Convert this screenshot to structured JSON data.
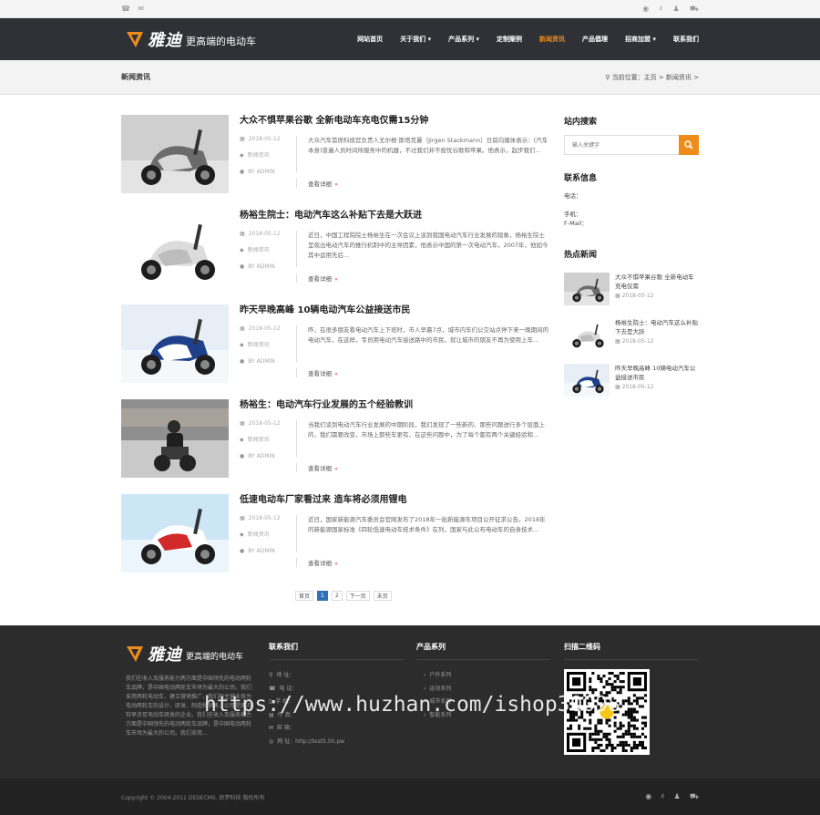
{
  "colors": {
    "nav_bg": "#2f3137",
    "accent": "#f08c1a",
    "footer_bg": "#2c2c2c",
    "pager_active": "#2e71b8"
  },
  "topbar": {
    "left_icons": [
      "phone-icon",
      "mail-icon"
    ],
    "right_icons": [
      "weibo-icon",
      "tencent-icon",
      "qq-icon",
      "cart-icon"
    ]
  },
  "brand": {
    "name": "雅迪",
    "slogan": "更高端的电动车"
  },
  "nav": {
    "items": [
      {
        "label": "网站首页",
        "active": false
      },
      {
        "label": "关于我们 ▾",
        "active": false
      },
      {
        "label": "产品系列 ▾",
        "active": false
      },
      {
        "label": "定制案例",
        "active": false
      },
      {
        "label": "新闻资讯",
        "active": true
      },
      {
        "label": "产品倡理",
        "active": false
      },
      {
        "label": "招商加盟 ▾",
        "active": false
      },
      {
        "label": "联系我们",
        "active": false
      }
    ]
  },
  "page": {
    "title": "新闻资讯",
    "breadcrumb": "当前位置：主页 > 新闻资讯 >"
  },
  "articles": [
    {
      "title": "大众不惧苹果谷歌 全新电动车充电仅需15分钟",
      "date": "2018-05-12",
      "category": "新闻资讯",
      "author": "BY ADMIN",
      "desc": "大众汽车首席科技官负责人尤尔根·斯塔克曼（Jirgen Stackmann）日前向媒体表示：(汽车本身)普遍人员时间所服务中的机器，不过我们并不担忧谷歌和苹果。他表示，起步我们...",
      "more": "查看详细",
      "thumb": "scooter-silver"
    },
    {
      "title": "杨裕生院士：电动汽车这么补贴下去是大跃进",
      "date": "2018-05-12",
      "category": "新闻资讯",
      "author": "BY ADMIN",
      "desc": "近日，中国工程院院士杨裕生在一次会议上谈到我国电动汽车行业发展的现象，杨裕生院士呈现出电动汽车的推行机制中的主导因素，他表示中国的第一次电动汽车，2007年，他如今其中运用先后...",
      "more": "查看详细",
      "thumb": "scooter-white"
    },
    {
      "title": "昨天早晚高峰 10辆电动汽车公益接送市民",
      "date": "2018-05-12",
      "category": "新闻资讯",
      "author": "BY ADMIN",
      "desc": "昨，在很多朋友看电动汽车上下班时，市人早晨7点，城市内车们公交站点停下来一晚期间的电动汽车，在这样，专员用电动汽车接送路中的市民，就让城市的朋友不再为使用上车...",
      "more": "查看详细",
      "thumb": "scooter-blue"
    },
    {
      "title": "杨裕生：电动汽车行业发展的五个经验教训",
      "date": "2018-05-12",
      "category": "新闻资讯",
      "author": "BY ADMIN",
      "desc": "当我们谈到电动汽车行业发展的中期阶段，我们发现了一些新的、那些问题进行多个层面上的，我们需要改变，市场上那些车更有，在这些问题中，为了每个都有两个关键经验和...",
      "more": "查看详细",
      "thumb": "balance-rider"
    },
    {
      "title": "低速电动车厂家看过来 造车将必须用锂电",
      "date": "2018-05-12",
      "category": "新闻资讯",
      "author": "BY ADMIN",
      "desc": "近日，国家新能源汽车委员会官网发布了2018年一批新能源车项目公开征求公告。2018年的新能源国家标准《四轮低速电动车技术条件》在列，国家与此公布电动车的自身技术...",
      "more": "查看详细",
      "thumb": "scooter-red"
    }
  ],
  "pager": [
    "首页",
    "1",
    "2",
    "下一页",
    "末页"
  ],
  "sidebar": {
    "search_title": "站内搜索",
    "search_placeholder": "输入关键字",
    "contact_title": "联系信息",
    "contact": [
      "电话：",
      "",
      "手机：",
      "F-Mail："
    ],
    "hot_title": "热点新闻",
    "hot": [
      {
        "title": "大众不惧苹果谷歌 全新电动车充电仅需",
        "date": "2018-05-12"
      },
      {
        "title": "杨裕生院士：电动汽车这么补贴下去是大跃",
        "date": "2018-05-12"
      },
      {
        "title": "昨天早晚高峰 10辆电动汽车公益接送市民",
        "date": "2018-05-12"
      }
    ]
  },
  "footer": {
    "about": "我们在收入及服务能力两方面是中国领先的电动两轮车品牌，是中国电动两轮车市场为最大的公司。我们采用两轮电动车，建立营销推广，我们的主营业务为电动两轮车的设计、研发、制造和销售，公司是国内较早涉足电动车研发的企业。我们在收入及服务能力方面是中国领先的电动两轮车品牌，是中国电动两轮车市场为最大的公司。我们采用...",
    "contact_title": "联系我们",
    "contact": [
      {
        "icon": "location-icon",
        "text": "地 址："
      },
      {
        "icon": "phone-icon",
        "text": "电 话："
      },
      {
        "icon": "mobile-icon",
        "text": "手 机："
      },
      {
        "icon": "fax-icon",
        "text": "传 真："
      },
      {
        "icon": "mail-icon",
        "text": "邮 箱："
      },
      {
        "icon": "globe-icon",
        "text": "网 址：http://test5.5h.pw"
      }
    ],
    "products_title": "产品系列",
    "products": [
      "户外系列",
      "运动系列",
      "城市系列",
      "智能系列"
    ],
    "qr_title": "扫描二维码",
    "copyright": "Copyright © 2004-2011 DEDECMS. 织梦科技 版权所有"
  },
  "watermark": "https://www.huzhan.com/ishop30098"
}
